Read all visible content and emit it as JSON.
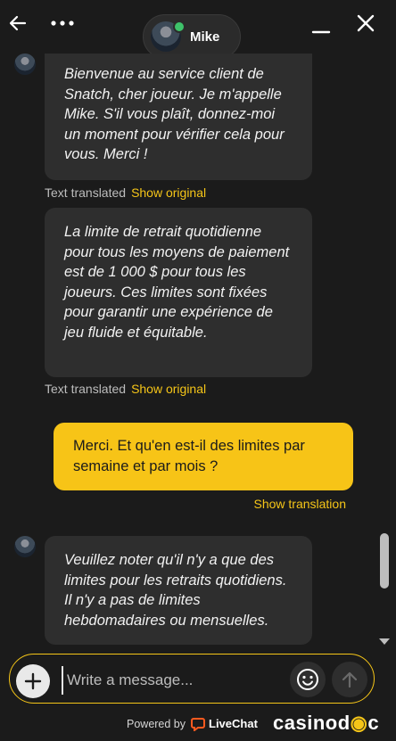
{
  "header": {
    "agent_name": "Mike"
  },
  "messages": [
    {
      "text": "Bienvenue au service client de Snatch, cher joueur. Je m'appelle Mike. S'il vous plaît, donnez-moi un moment pour vérifier cela pour vous. Merci !",
      "meta": "Text translated",
      "link": "Show original"
    },
    {
      "text": "La limite de retrait quotidienne pour tous les moyens de paiement est de 1 000 $ pour tous les joueurs. Ces limites sont fixées pour garantir une expérience de jeu fluide et équitable.",
      "meta": "Text translated",
      "link": "Show original"
    },
    {
      "text": "Merci. Et qu'en est-il des limites par semaine et par mois ?",
      "link": "Show translation"
    },
    {
      "text": "Veuillez noter qu'il n'y a que des limites pour les retraits quotidiens. Il n'y a pas de limites hebdomadaires ou mensuelles."
    }
  ],
  "composer": {
    "placeholder": "Write a message..."
  },
  "footer": {
    "powered_by": "Powered by",
    "livechat": "LiveChat",
    "brand_a": "casino",
    "brand_b": "d",
    "brand_c": "c"
  },
  "colors": {
    "accent": "#f5c518",
    "user_bubble": "#f7c417",
    "agent_bubble": "#2e2e2e",
    "background": "#1b1b1b",
    "online": "#3ec26a"
  }
}
